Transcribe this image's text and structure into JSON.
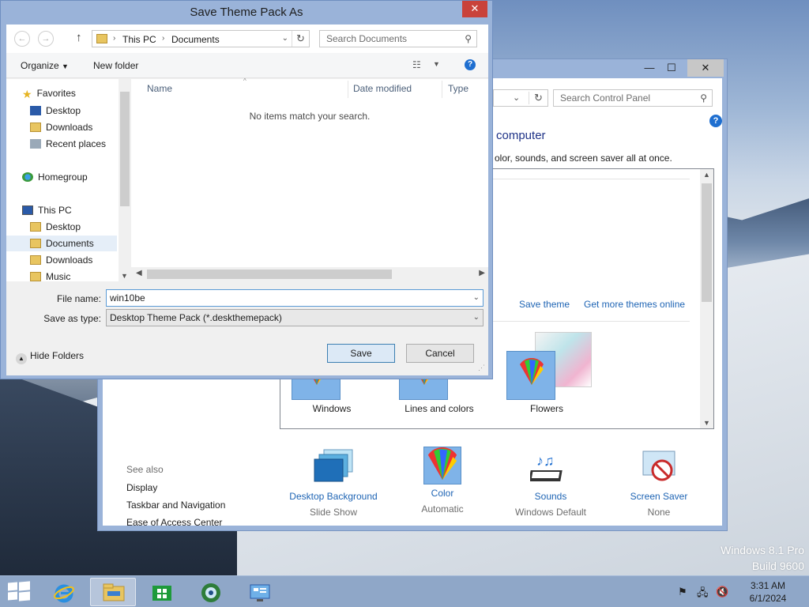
{
  "desktop": {
    "watermark_line1": "Windows 8.1 Pro",
    "watermark_line2": "Build 9600"
  },
  "control_panel": {
    "search_placeholder": "Search Control Panel",
    "heading": "computer",
    "description": "olor, sounds, and screen saver all at once.",
    "save_theme": "Save theme",
    "get_more_themes": "Get more themes online",
    "themes": [
      {
        "label": "Windows"
      },
      {
        "label": "Lines and colors"
      },
      {
        "label": "Flowers"
      }
    ],
    "see_also": {
      "header": "See also",
      "links": [
        "Display",
        "Taskbar and Navigation",
        "Ease of Access Center"
      ]
    },
    "bottom": [
      {
        "label": "Desktop Background",
        "sub": "Slide Show"
      },
      {
        "label": "Color",
        "sub": "Automatic"
      },
      {
        "label": "Sounds",
        "sub": "Windows Default"
      },
      {
        "label": "Screen Saver",
        "sub": "None"
      }
    ]
  },
  "dialog": {
    "title": "Save Theme Pack As",
    "address": {
      "crumb1": "This PC",
      "crumb2": "Documents"
    },
    "search_placeholder": "Search Documents",
    "toolbar": {
      "organize": "Organize",
      "new_folder": "New folder"
    },
    "nav": {
      "favorites": "Favorites",
      "fav_desktop": "Desktop",
      "fav_downloads": "Downloads",
      "fav_recent": "Recent places",
      "homegroup": "Homegroup",
      "this_pc": "This PC",
      "pc_desktop": "Desktop",
      "pc_documents": "Documents",
      "pc_downloads": "Downloads",
      "pc_music": "Music"
    },
    "columns": {
      "name": "Name",
      "date": "Date modified",
      "type": "Type"
    },
    "empty_message": "No items match your search.",
    "file_name_label": "File name:",
    "file_name_value": "win10be",
    "save_as_label": "Save as type:",
    "save_as_value": "Desktop Theme Pack (*.deskthemepack)",
    "hide_folders": "Hide Folders",
    "save_button": "Save",
    "cancel_button": "Cancel"
  },
  "taskbar": {
    "time": "3:31 AM",
    "date": "6/1/2024"
  }
}
